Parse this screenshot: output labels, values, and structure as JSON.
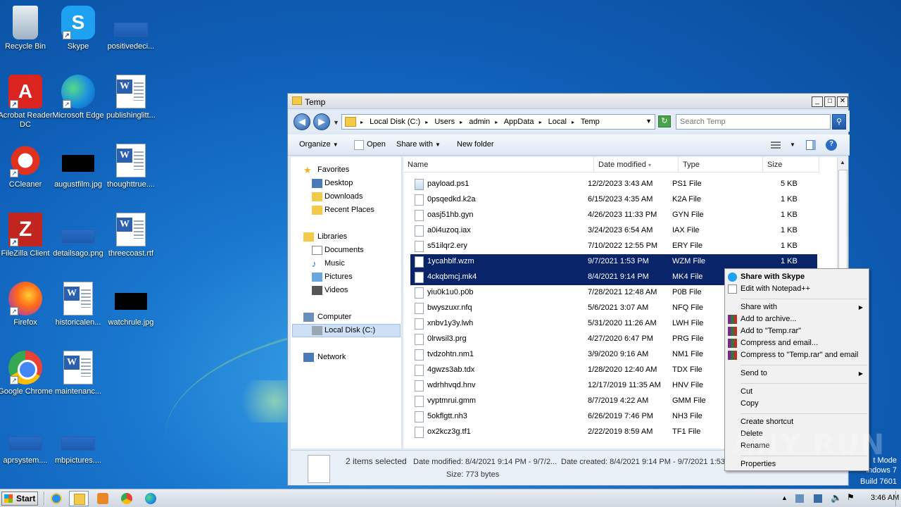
{
  "desktop": {
    "icons": [
      {
        "label": "Recycle Bin",
        "icon": "recycle-bin-icon"
      },
      {
        "label": "Skype",
        "icon": "skype-icon"
      },
      {
        "label": "positivedeci...",
        "icon": "file-icon"
      },
      {
        "label": "Acrobat Reader DC",
        "icon": "acrobat-icon"
      },
      {
        "label": "Microsoft Edge",
        "icon": "edge-icon"
      },
      {
        "label": "publishinglitt...",
        "icon": "word-doc-icon"
      },
      {
        "label": "CCleaner",
        "icon": "ccleaner-icon"
      },
      {
        "label": "augustfilm.jpg",
        "icon": "image-icon"
      },
      {
        "label": "thoughttrue....",
        "icon": "word-doc-icon"
      },
      {
        "label": "FileZilla Client",
        "icon": "filezilla-icon"
      },
      {
        "label": "detailsago.png",
        "icon": "image-icon"
      },
      {
        "label": "threecoast.rtf",
        "icon": "word-doc-icon"
      },
      {
        "label": "Firefox",
        "icon": "firefox-icon"
      },
      {
        "label": "historicalen...",
        "icon": "word-doc-icon"
      },
      {
        "label": "watchrule.jpg",
        "icon": "image-icon"
      },
      {
        "label": "Google Chrome",
        "icon": "chrome-icon"
      },
      {
        "label": "maintenanc...",
        "icon": "word-doc-icon"
      },
      {
        "label": "aprsystem....",
        "icon": "file-icon"
      },
      {
        "label": "mbpictures....",
        "icon": "file-icon"
      }
    ],
    "watermark": "ANY RUN",
    "windows_text": {
      "line1": "t Mode",
      "line2": "indows 7",
      "line3": "Build 7601"
    }
  },
  "window": {
    "title": "Temp",
    "buttons": {
      "minimize": "_",
      "maximize": "□",
      "close": "✕"
    },
    "breadcrumbs": [
      "Local Disk (C:)",
      "Users",
      "admin",
      "AppData",
      "Local",
      "Temp"
    ],
    "search_placeholder": "Search Temp",
    "toolbar": {
      "organize": "Organize",
      "open": "Open",
      "share_with": "Share with",
      "new_folder": "New folder"
    },
    "nav": {
      "favorites": "Favorites",
      "desktop": "Desktop",
      "downloads": "Downloads",
      "recent_places": "Recent Places",
      "libraries": "Libraries",
      "documents": "Documents",
      "music": "Music",
      "pictures": "Pictures",
      "videos": "Videos",
      "computer": "Computer",
      "local_disk": "Local Disk (C:)",
      "network": "Network"
    },
    "columns": {
      "name": "Name",
      "date": "Date modified",
      "type": "Type",
      "size": "Size"
    },
    "files": [
      {
        "name": "payload.ps1",
        "date": "12/2/2023 3:43 AM",
        "type": "PS1 File",
        "size": "5 KB"
      },
      {
        "name": "0psqedkd.k2a",
        "date": "6/15/2023 4:35 AM",
        "type": "K2A File",
        "size": "1 KB"
      },
      {
        "name": "oasj51hb.gyn",
        "date": "4/26/2023 11:33 PM",
        "type": "GYN File",
        "size": "1 KB"
      },
      {
        "name": "a0i4uzoq.iax",
        "date": "3/24/2023 6:54 AM",
        "type": "IAX File",
        "size": "1 KB"
      },
      {
        "name": "s51ilqr2.ery",
        "date": "7/10/2022 12:55 PM",
        "type": "ERY File",
        "size": "1 KB"
      },
      {
        "name": "1ycahblf.wzm",
        "date": "9/7/2021 1:53 PM",
        "type": "WZM File",
        "size": "1 KB"
      },
      {
        "name": "4ckqbmcj.mk4",
        "date": "8/4/2021 9:14 PM",
        "type": "MK4 File",
        "size": ""
      },
      {
        "name": "yiu0k1u0.p0b",
        "date": "7/28/2021 12:48 AM",
        "type": "P0B File",
        "size": ""
      },
      {
        "name": "bwyszuxr.nfq",
        "date": "5/6/2021 3:07 AM",
        "type": "NFQ File",
        "size": ""
      },
      {
        "name": "xnbv1y3y.lwh",
        "date": "5/31/2020 11:26 AM",
        "type": "LWH File",
        "size": ""
      },
      {
        "name": "0lrwsil3.prg",
        "date": "4/27/2020 6:47 PM",
        "type": "PRG File",
        "size": ""
      },
      {
        "name": "tvdzohtn.nm1",
        "date": "3/9/2020 9:16 AM",
        "type": "NM1 File",
        "size": ""
      },
      {
        "name": "4gwzs3ab.tdx",
        "date": "1/28/2020 12:40 AM",
        "type": "TDX File",
        "size": ""
      },
      {
        "name": "wdrhhvqd.hnv",
        "date": "12/17/2019 11:35 AM",
        "type": "HNV File",
        "size": ""
      },
      {
        "name": "vyptmrui.gmm",
        "date": "8/7/2019 4:22 AM",
        "type": "GMM File",
        "size": ""
      },
      {
        "name": "5okflgtt.nh3",
        "date": "6/26/2019 7:46 PM",
        "type": "NH3 File",
        "size": ""
      },
      {
        "name": "ox2kcz3g.tf1",
        "date": "2/22/2019 8:59 AM",
        "type": "TF1 File",
        "size": ""
      }
    ],
    "details": {
      "selected": "2 items selected",
      "modified": "Date modified: 8/4/2021 9:14 PM - 9/7/2...",
      "created": "Date created: 8/4/2021 9:14 PM - 9/7/2021 1:53",
      "size": "Size: 773 bytes"
    }
  },
  "context_menu": {
    "share_skype": "Share with Skype",
    "edit_notepad": "Edit with Notepad++",
    "share_with": "Share with",
    "add_archive": "Add to archive...",
    "add_temp_rar": "Add to \"Temp.rar\"",
    "compress_email": "Compress and email...",
    "compress_temp_email": "Compress to \"Temp.rar\" and email",
    "send_to": "Send to",
    "cut": "Cut",
    "copy": "Copy",
    "create_shortcut": "Create shortcut",
    "delete": "Delete",
    "rename": "Rename",
    "properties": "Properties"
  },
  "taskbar": {
    "start": "Start",
    "time": "3:46 AM"
  }
}
